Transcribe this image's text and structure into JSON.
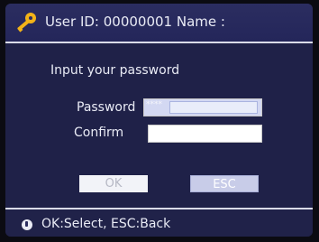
{
  "header": {
    "title": "User ID: 00000001 Name :",
    "icon": "key-icon"
  },
  "form": {
    "prompt": "Input your password",
    "password_label": "Password",
    "password_value": "****",
    "confirm_label": "Confirm",
    "confirm_value": ""
  },
  "buttons": {
    "ok_label": "OK",
    "esc_label": "ESC"
  },
  "footer": {
    "hint": "OK:Select, ESC:Back",
    "icon": "info-icon"
  },
  "colors": {
    "panel": "#1f2148",
    "header": "#2b2d60",
    "text": "#e9ebf5",
    "key": "#f3b318"
  }
}
